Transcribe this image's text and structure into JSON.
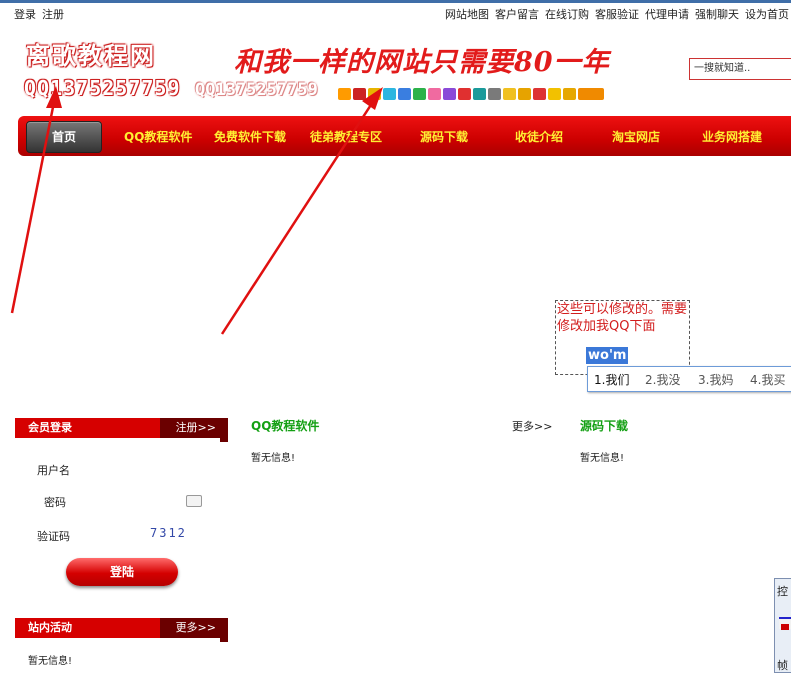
{
  "top_links": {
    "left": [
      "登录",
      "注册"
    ],
    "right": [
      "网站地图",
      "客户留言",
      "在线订购",
      "客服验证",
      "代理申请",
      "强制聊天",
      "设为首页"
    ]
  },
  "header": {
    "site_name": "离歌教程网",
    "qq_display": "QQ1375257759",
    "qq_display_faded": "QQ1375257759",
    "slogan": "和我一样的网站只需要80一年",
    "search_placeholder": "一搜就知道.."
  },
  "nav": {
    "home": "首页",
    "items": [
      "QQ教程软件",
      "免费软件下载",
      "徒弟教程专区",
      "源码下载",
      "收徒介绍",
      "淘宝网店",
      "业务网搭建"
    ]
  },
  "annotation": {
    "note": "这些可以修改的。需要修改加我QQ下面"
  },
  "ime": {
    "composition": "wo'm",
    "candidates": [
      "1.我们",
      "2.我没",
      "3.我妈",
      "4.我买"
    ]
  },
  "login": {
    "title": "会员登录",
    "register": "注册>>",
    "username_label": "用户名",
    "password_label": "密码",
    "captcha_label": "验证码",
    "captcha_value": "7312",
    "submit": "登陆"
  },
  "activity": {
    "title": "站内活动",
    "more": "更多>>",
    "empty": "暂无信息!"
  },
  "sections": {
    "qq": {
      "title": "QQ教程软件",
      "more": "更多>>",
      "empty": "暂无信息!"
    },
    "source": {
      "title": "源码下载",
      "empty": "暂无信息!"
    }
  },
  "widget": {
    "top": "控",
    "bottom": "帧"
  },
  "colors": {
    "brand_red": "#d60000",
    "nav_text": "#ffef33",
    "section_green": "#14a014",
    "arrow_red": "#e01010"
  }
}
